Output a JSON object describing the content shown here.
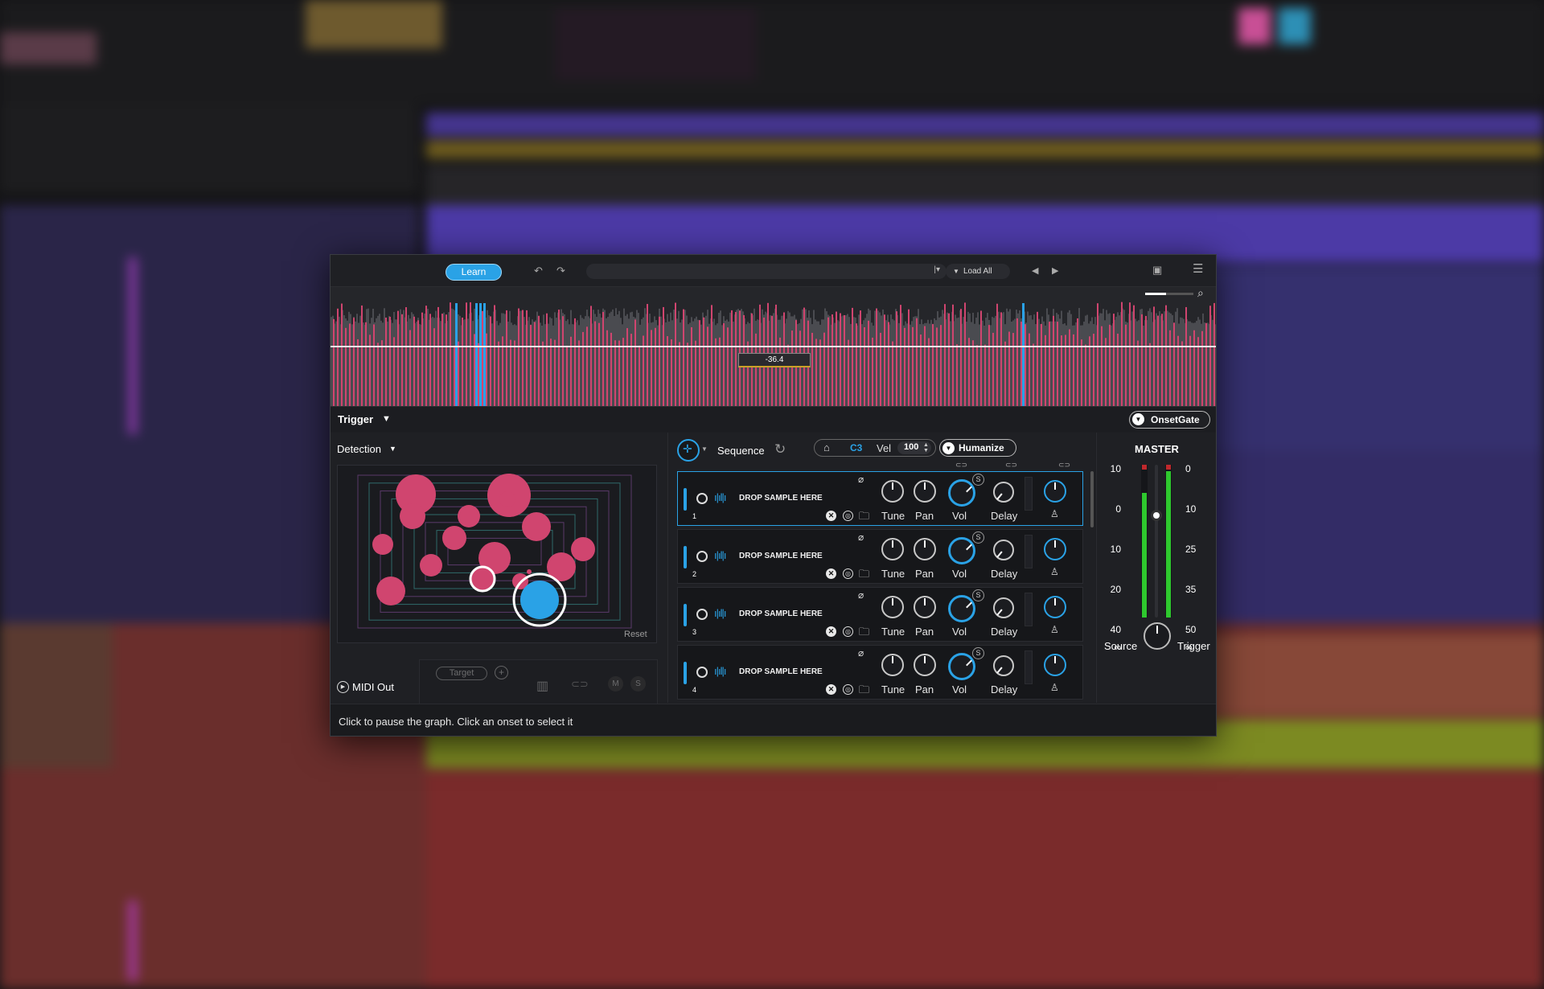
{
  "toolbar": {
    "learn_label": "Learn",
    "undo_icon": "undo-icon",
    "redo_icon": "redo-icon",
    "load_all_label": "Load All"
  },
  "waveform": {
    "threshold_value": "-36.4"
  },
  "trigger": {
    "label": "Trigger",
    "mode_label": "OnsetGate"
  },
  "detection": {
    "label": "Detection",
    "reset_label": "Reset"
  },
  "midi": {
    "out_label": "MIDI Out",
    "target_label": "Target",
    "mute_label": "M",
    "solo_label": "S"
  },
  "sequence": {
    "label": "Sequence",
    "note": "C3",
    "vel_label": "Vel",
    "vel_value": "100",
    "humanize_label": "Humanize"
  },
  "strips": [
    {
      "number": "1",
      "drop_label": "DROP SAMPLE HERE",
      "tune": "Tune",
      "pan": "Pan",
      "vol": "Vol",
      "delay": "Delay",
      "selected": true
    },
    {
      "number": "2",
      "drop_label": "DROP SAMPLE HERE",
      "tune": "Tune",
      "pan": "Pan",
      "vol": "Vol",
      "delay": "Delay",
      "selected": false
    },
    {
      "number": "3",
      "drop_label": "DROP SAMPLE HERE",
      "tune": "Tune",
      "pan": "Pan",
      "vol": "Vol",
      "delay": "Delay",
      "selected": false
    },
    {
      "number": "4",
      "drop_label": "DROP SAMPLE HERE",
      "tune": "Tune",
      "pan": "Pan",
      "vol": "Vol",
      "delay": "Delay",
      "selected": false
    }
  ],
  "master": {
    "title": "MASTER",
    "left_scale": [
      "10",
      "0",
      "10",
      "20",
      "40",
      "∞"
    ],
    "right_scale": [
      "0",
      "10",
      "25",
      "35",
      "50",
      "∞"
    ],
    "source_label": "Source",
    "trigger_label": "Trigger"
  },
  "status": {
    "text": "Click to pause the graph. Click an onset to select it"
  },
  "colors": {
    "accent": "#2aa2e6",
    "onset": "#d0456f",
    "meter": "#2ec82e"
  }
}
